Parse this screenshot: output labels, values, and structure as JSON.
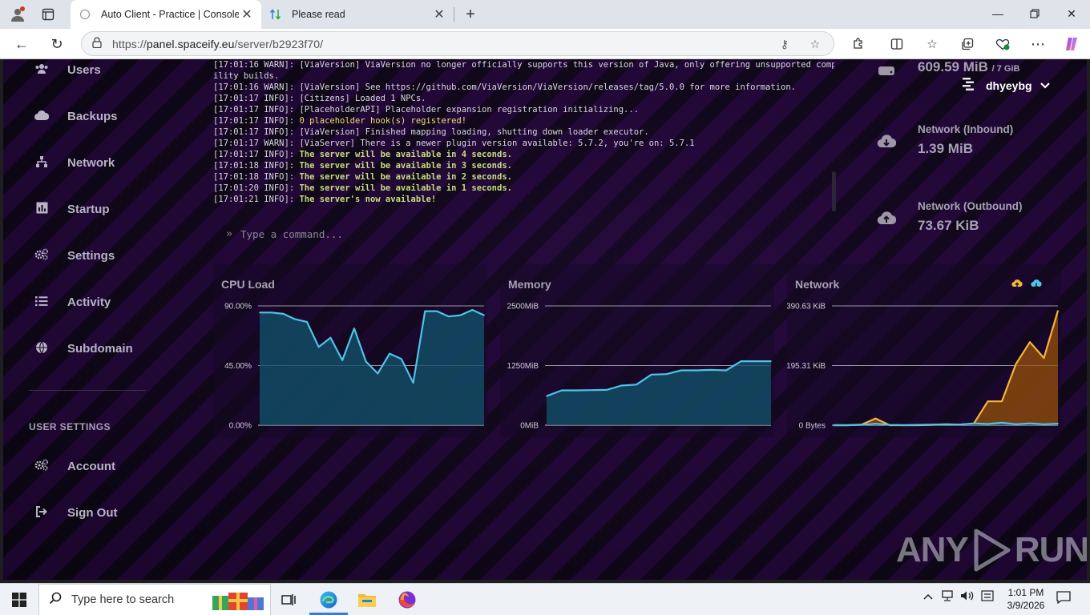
{
  "browser": {
    "tabs": [
      {
        "title": "Auto Client - Practice | Console",
        "active": true
      },
      {
        "title": "Please read",
        "active": false
      }
    ],
    "url_scheme": "https://",
    "url_host": "panel.spaceify.eu",
    "url_path": "/server/b2923f70/"
  },
  "sidebar": {
    "items": [
      {
        "label": "Users",
        "icon": "users-icon"
      },
      {
        "label": "Backups",
        "icon": "cloud-icon"
      },
      {
        "label": "Network",
        "icon": "network-icon"
      },
      {
        "label": "Startup",
        "icon": "chart-icon"
      },
      {
        "label": "Settings",
        "icon": "gears-icon"
      },
      {
        "label": "Activity",
        "icon": "list-icon"
      },
      {
        "label": "Subdomain",
        "icon": "globe-icon"
      }
    ],
    "user_settings_heading": "USER SETTINGS",
    "user_items": [
      {
        "label": "Account",
        "icon": "gears-icon"
      },
      {
        "label": "Sign Out",
        "icon": "sign-out-icon"
      }
    ]
  },
  "console": {
    "lines": [
      {
        "prefix": "[17:01:16 WARN]: ",
        "text": "[ViaVersion] ViaVersion no longer officially supports this version of Java, only offering unsupported compatib",
        "style": "plain"
      },
      {
        "prefix": "",
        "text": "ility builds.",
        "style": "plain"
      },
      {
        "prefix": "[17:01:16 WARN]: ",
        "text": "[ViaVersion] See https://github.com/ViaVersion/ViaVersion/releases/tag/5.0.0 for more information.",
        "style": "plain"
      },
      {
        "prefix": "[17:01:17 INFO]: ",
        "text": "[Citizens] Loaded 1 NPCs.",
        "style": "plain"
      },
      {
        "prefix": "[17:01:17 INFO]: ",
        "text": "[PlaceholderAPI] Placeholder expansion registration initializing...",
        "style": "plain"
      },
      {
        "prefix": "[17:01:17 INFO]: ",
        "text": "0 placeholder hook(s) registered!",
        "style": "yellow"
      },
      {
        "prefix": "[17:01:17 INFO]: ",
        "text": "[ViaVersion] Finished mapping loading, shutting down loader executor.",
        "style": "plain"
      },
      {
        "prefix": "[17:01:17 WARN]: ",
        "text": "[ViaServer] There is a newer plugin version available: 5.7.2, you're on: 5.7.1",
        "style": "plain"
      },
      {
        "prefix": "[17:01:17 INFO]: ",
        "text": "The server will be available in 4 seconds.",
        "style": "green"
      },
      {
        "prefix": "[17:01:18 INFO]: ",
        "text": "The server will be available in 3 seconds.",
        "style": "green"
      },
      {
        "prefix": "[17:01:18 INFO]: ",
        "text": "The server will be available in 2 seconds.",
        "style": "green"
      },
      {
        "prefix": "[17:01:20 INFO]: ",
        "text": "The server will be available in 1 seconds.",
        "style": "green"
      },
      {
        "prefix": "[17:01:21 INFO]: ",
        "text": "The server's now available!",
        "style": "green"
      }
    ],
    "command_placeholder": "Type a command..."
  },
  "stats": {
    "memory_value": "609.59 MiB",
    "memory_limit": "/ 7 GiB",
    "net_in_label": "Network (Inbound)",
    "net_in_value": "1.39 MiB",
    "net_out_label": "Network (Outbound)",
    "net_out_value": "73.67 KiB"
  },
  "user": {
    "name": "dhyeybg"
  },
  "chart_data": [
    {
      "type": "area",
      "title": "CPU Load",
      "ylim": [
        0,
        90
      ],
      "y_ticks": [
        "90.00%",
        "45.00%",
        "0.00%"
      ],
      "series": [
        {
          "values": [
            85,
            85,
            84,
            80,
            78,
            59,
            66,
            49,
            73,
            48,
            39,
            54,
            50,
            32,
            86,
            86,
            82,
            83,
            87,
            83
          ],
          "color": "#4fc3e8"
        }
      ]
    },
    {
      "type": "area",
      "title": "Memory",
      "ylim": [
        0,
        2500
      ],
      "y_ticks": [
        "2500MiB",
        "1250MiB",
        "0MiB"
      ],
      "series": [
        {
          "values": [
            610,
            730,
            730,
            735,
            740,
            830,
            850,
            1060,
            1070,
            1150,
            1150,
            1160,
            1150,
            1340,
            1340,
            1340
          ],
          "color": "#4fc3e8"
        }
      ]
    },
    {
      "type": "area",
      "title": "Network",
      "ylim": [
        0,
        390.63
      ],
      "y_ticks": [
        "390.63 KiB",
        "195.31 KiB",
        "0 Bytes"
      ],
      "series": [
        {
          "values": [
            0,
            0,
            2,
            22,
            0,
            0,
            0,
            1,
            3,
            2,
            5,
            78,
            78,
            200,
            272,
            220,
            375
          ],
          "color": "#f5b636"
        },
        {
          "values": [
            0,
            0,
            1,
            5,
            1,
            0,
            1,
            2,
            3,
            2,
            6,
            4,
            8,
            3,
            6,
            3,
            5
          ],
          "color": "#4fc3e8"
        }
      ]
    }
  ],
  "watermark": {
    "left": "ANY",
    "right": "RUN"
  },
  "taskbar": {
    "search_placeholder": "Type here to search",
    "time": "1:01 PM",
    "date": "3/9/2026"
  }
}
